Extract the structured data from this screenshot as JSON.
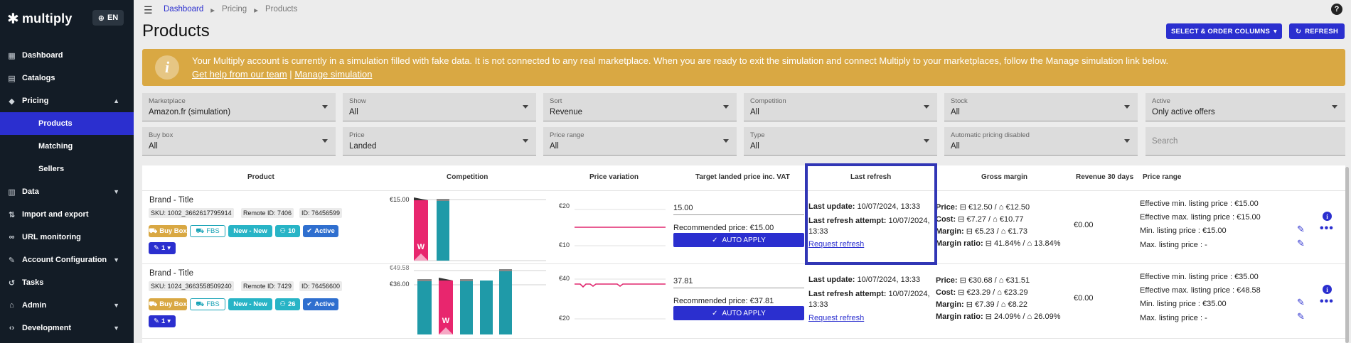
{
  "app": {
    "logo": "multiply",
    "lang": "EN"
  },
  "sidebar": {
    "items": [
      {
        "label": "Dashboard",
        "icon": "dashboard-icon"
      },
      {
        "label": "Catalogs",
        "icon": "catalog-icon"
      },
      {
        "label": "Pricing",
        "icon": "tag-icon",
        "expanded": true
      },
      {
        "label": "Products",
        "sub": true,
        "active": true
      },
      {
        "label": "Matching",
        "sub": true
      },
      {
        "label": "Sellers",
        "sub": true
      },
      {
        "label": "Data",
        "icon": "chart-icon"
      },
      {
        "label": "Import and export",
        "icon": "import-export-icon"
      },
      {
        "label": "URL monitoring",
        "icon": "link-icon"
      },
      {
        "label": "Account Configuration",
        "icon": "wrench-icon"
      },
      {
        "label": "Tasks",
        "icon": "history-icon"
      },
      {
        "label": "Admin",
        "icon": "admin-icon"
      },
      {
        "label": "Development",
        "icon": "code-icon"
      }
    ]
  },
  "breadcrumb": [
    "Dashboard",
    "Pricing",
    "Products"
  ],
  "page": {
    "title": "Products",
    "select_columns_label": "SELECT & ORDER COLUMNS",
    "refresh_label": "REFRESH"
  },
  "banner": {
    "message": "Your Multiply account is currently in a simulation filled with fake data. It is not connected to any real marketplace. When you are ready to exit the simulation and connect Multiply to your marketplaces, follow the Manage simulation link below.",
    "help_link": "Get help from our team",
    "separator": "|",
    "manage_link": "Manage simulation"
  },
  "filters": {
    "marketplace": {
      "label": "Marketplace",
      "value": "Amazon.fr (simulation)"
    },
    "show": {
      "label": "Show",
      "value": "All"
    },
    "sort": {
      "label": "Sort",
      "value": "Revenue"
    },
    "competition": {
      "label": "Competition",
      "value": "All"
    },
    "stock": {
      "label": "Stock",
      "value": "All"
    },
    "active": {
      "label": "Active",
      "value": "Only active offers"
    },
    "buybox": {
      "label": "Buy box",
      "value": "All"
    },
    "price": {
      "label": "Price",
      "value": "Landed"
    },
    "price_range": {
      "label": "Price range",
      "value": "All"
    },
    "type": {
      "label": "Type",
      "value": "All"
    },
    "auto_pricing": {
      "label": "Automatic pricing disabled",
      "value": "All"
    },
    "search": {
      "placeholder": "Search"
    }
  },
  "table": {
    "headers": {
      "product": "Product",
      "competition": "Competition",
      "price_variation": "Price variation",
      "target": "Target landed price inc. VAT",
      "last_refresh": "Last refresh",
      "gross_margin": "Gross margin",
      "revenue": "Revenue 30 days",
      "price_range": "Price range"
    },
    "rows": [
      {
        "title": "Brand - Title",
        "sku": "SKU: 1002_3662617795914",
        "remote_id": "Remote ID: 7406",
        "id": "ID: 76456599",
        "badges": {
          "buybox": "Buy Box",
          "fbs": "FBS",
          "new": "New - New",
          "count": "10",
          "active": "Active",
          "tag": "1"
        },
        "comp_label": "€15.00",
        "var_top": "€20",
        "var_bottom": "€10",
        "target": "15.00",
        "recommended": "Recommended price: €15.00",
        "apply": "AUTO APPLY",
        "last_update_label": "Last update:",
        "last_update": "10/07/2024, 13:33",
        "last_attempt_label": "Last refresh attempt:",
        "last_attempt_a": "10/07/2024,",
        "last_attempt_b": "13:33",
        "request_refresh": "Request refresh",
        "margin": {
          "price": "€12.50 / ",
          "price2": "€12.50",
          "cost": "€7.27 / ",
          "cost2": "€10.77",
          "margin": "€5.23 / ",
          "margin2": "€1.73",
          "ratio": "41.84% / ",
          "ratio2": "13.84%"
        },
        "revenue": "€0.00",
        "range": {
          "eff_min": "Effective min. listing price :  €15.00",
          "eff_max": "Effective max. listing price :  €15.00",
          "min": "Min. listing price :  €15.00",
          "max": "Max. listing price :  -"
        }
      },
      {
        "title": "Brand - Title",
        "sku": "SKU: 1024_3663558509240",
        "remote_id": "Remote ID: 7429",
        "id": "ID: 76456600",
        "badges": {
          "buybox": "Buy Box",
          "fbs": "FBS",
          "new": "New - New",
          "count": "26",
          "active": "Active",
          "tag": "1"
        },
        "comp_label": "€36.00",
        "comp_label_top": "€49.58",
        "var_top": "€40",
        "var_bottom": "€20",
        "target": "37.81",
        "recommended": "Recommended price: €37.81",
        "apply": "AUTO APPLY",
        "last_update_label": "Last update:",
        "last_update": "10/07/2024, 13:33",
        "last_attempt_label": "Last refresh attempt:",
        "last_attempt_a": "10/07/2024,",
        "last_attempt_b": "13:33",
        "request_refresh": "Request refresh",
        "margin": {
          "price": "€30.68 / ",
          "price2": "€31.51",
          "cost": "€23.29 / ",
          "cost2": "€23.29",
          "margin": "€7.39 / ",
          "margin2": "€8.22",
          "ratio": "24.09% / ",
          "ratio2": "26.09%"
        },
        "revenue": "€0.00",
        "range": {
          "eff_min": "Effective min. listing price :  €35.00",
          "eff_max": "Effective max. listing price :  €48.58",
          "min": "Min. listing price :  €35.00",
          "max": "Max. listing price :  -"
        }
      }
    ],
    "margin_labels": {
      "price": "Price:",
      "cost": "Cost:",
      "margin": "Margin:",
      "ratio": "Margin ratio:"
    },
    "competition_marker": "W"
  },
  "colors": {
    "accent": "#2b2fcf",
    "sidebar": "#131c26",
    "banner": "#d9a843",
    "buybox_bar": "#e8266e",
    "comp_bar": "#1f9aa8",
    "highlight": "#3136b5"
  }
}
